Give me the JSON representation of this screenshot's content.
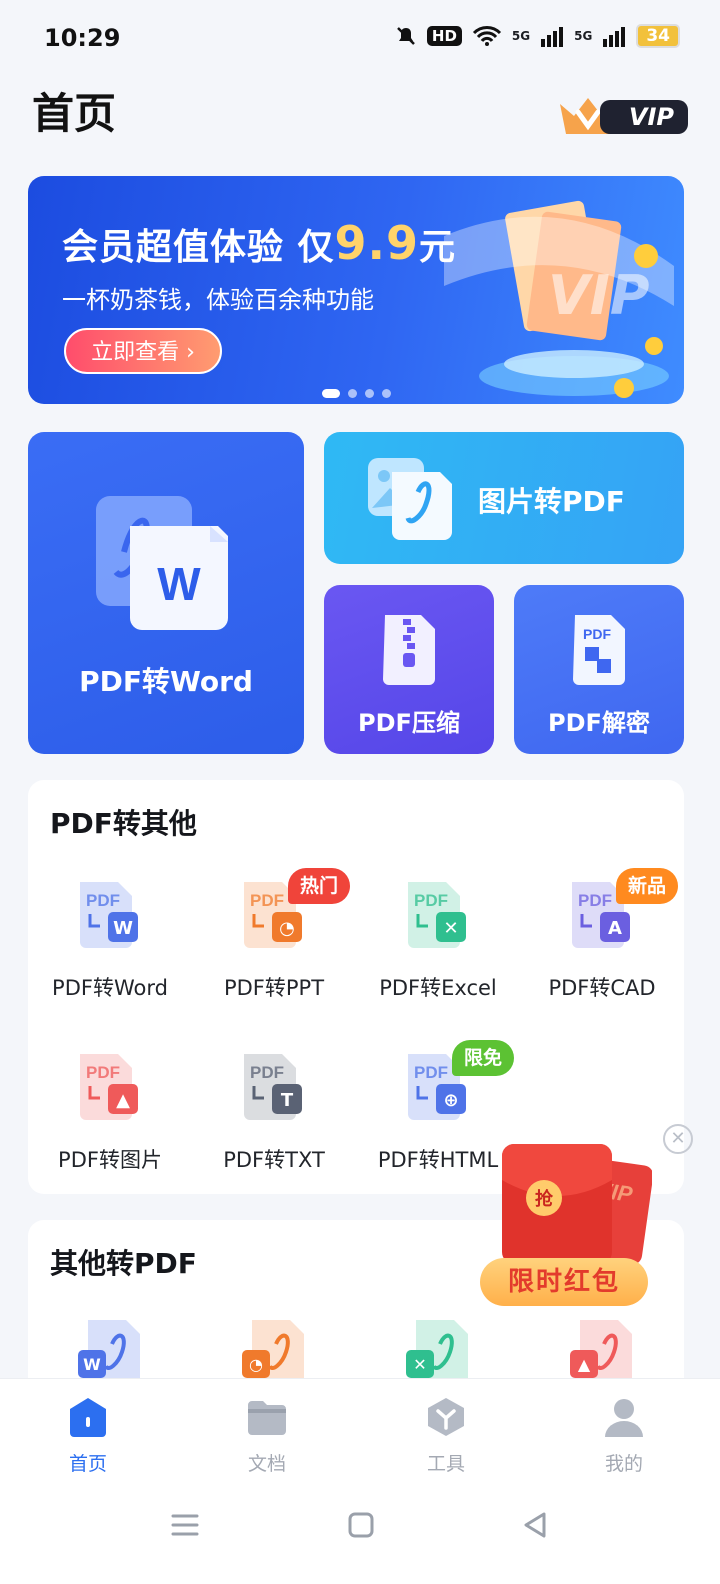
{
  "status": {
    "time": "10:29",
    "network": "5G",
    "hd": "HD",
    "battery": "34"
  },
  "header": {
    "title": "首页",
    "vip_label": "VIP"
  },
  "banner": {
    "title_prefix": "会员超值体验 仅",
    "price": "9.9",
    "title_suffix": "元",
    "subtitle": "一杯奶茶钱，体验百余种功能",
    "button": "立即查看 ›",
    "art_text": "VIP",
    "page_count": 4,
    "current_page": 1
  },
  "features": {
    "pdf_to_word": "PDF转Word",
    "img_to_pdf": "图片转PDF",
    "pdf_compress": "PDF压缩",
    "pdf_decrypt": "PDF解密",
    "icon_word_letter": "W",
    "icon_pdf_text": "PDF"
  },
  "section_pdf_to_other": {
    "title": "PDF转其他",
    "icon_label": "PDF",
    "items": [
      {
        "label": "PDF转Word",
        "icon": "pdf-to-word-icon",
        "color": "#4f73e8",
        "glyph": "W",
        "badge": ""
      },
      {
        "label": "PDF转PPT",
        "icon": "pdf-to-ppt-icon",
        "color": "#f07a2c",
        "glyph": "◔",
        "badge": "热门"
      },
      {
        "label": "PDF转Excel",
        "icon": "pdf-to-excel-icon",
        "color": "#2fbf8f",
        "glyph": "✕",
        "badge": ""
      },
      {
        "label": "PDF转CAD",
        "icon": "pdf-to-cad-icon",
        "color": "#6b5fe0",
        "glyph": "A",
        "badge": "新品"
      },
      {
        "label": "PDF转图片",
        "icon": "pdf-to-image-icon",
        "color": "#ef5a5a",
        "glyph": "▲",
        "badge": ""
      },
      {
        "label": "PDF转TXT",
        "icon": "pdf-to-txt-icon",
        "color": "#5a6274",
        "glyph": "T",
        "badge": ""
      },
      {
        "label": "PDF转HTML",
        "icon": "pdf-to-html-icon",
        "color": "#4f73e8",
        "glyph": "⊕",
        "badge": "限免"
      }
    ]
  },
  "section_other_to_pdf": {
    "title": "其他转PDF",
    "items": [
      {
        "icon": "word-to-pdf-icon",
        "color": "#4f73e8",
        "glyph": "W"
      },
      {
        "icon": "ppt-to-pdf-icon",
        "color": "#f07a2c",
        "glyph": "◔"
      },
      {
        "icon": "excel-to-pdf-icon",
        "color": "#2fbf8f",
        "glyph": "✕"
      },
      {
        "icon": "image-to-pdf-icon",
        "color": "#ef5a5a",
        "glyph": "▲"
      }
    ]
  },
  "promo": {
    "label": "限时红包",
    "grab": "抢",
    "card_text": "VIP"
  },
  "nav": {
    "active": 0,
    "tabs": [
      {
        "label": "首页",
        "icon": "home-icon"
      },
      {
        "label": "文档",
        "icon": "folder-icon"
      },
      {
        "label": "工具",
        "icon": "toolbox-icon"
      },
      {
        "label": "我的",
        "icon": "profile-icon"
      }
    ]
  },
  "colors": {
    "accent": "#2c6ff0",
    "hot": "#f0443a",
    "new": "#ff8a1f",
    "free": "#5cc233"
  }
}
